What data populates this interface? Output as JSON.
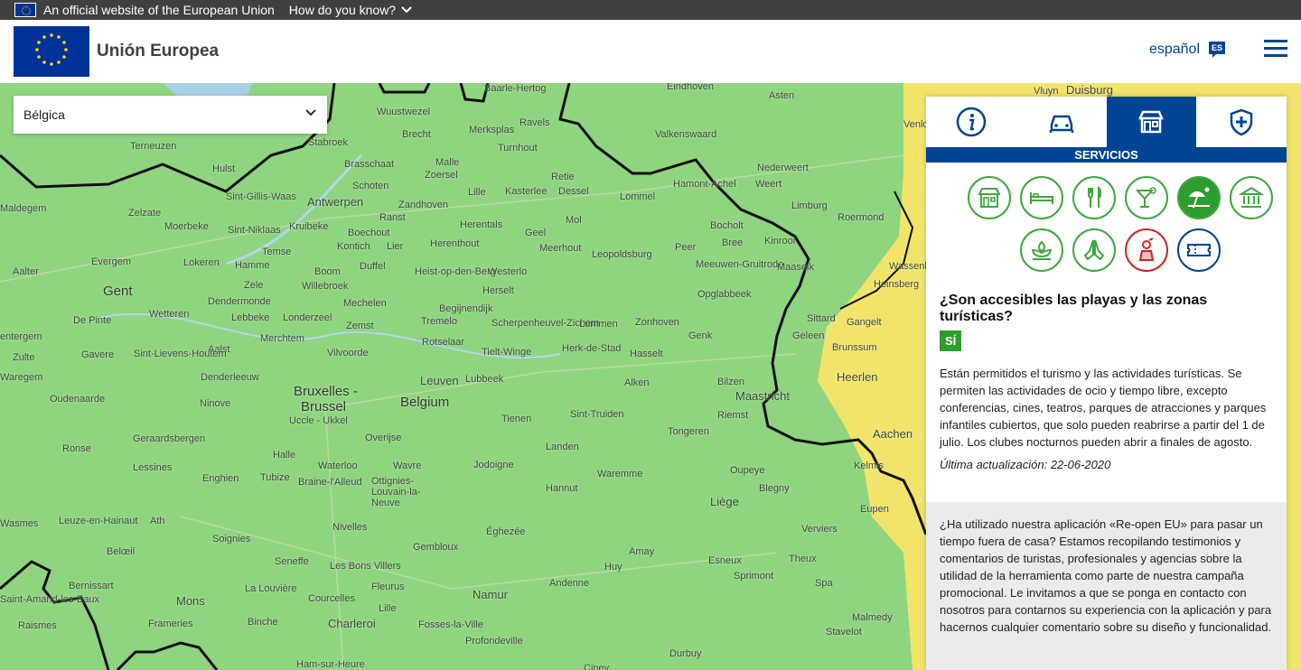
{
  "eu_bar": {
    "official_text": "An official website of the European Union",
    "how_text": "How do you know?"
  },
  "header": {
    "site_name": "Unión Europea",
    "language_label": "español",
    "language_code": "ES"
  },
  "country_select": {
    "value": "Bélgica"
  },
  "panel": {
    "tabs": [
      "info-icon",
      "car-icon",
      "shop-icon",
      "health-shield-icon"
    ],
    "active_tab": "SERVICIOS",
    "service_icons": [
      "shop-icon",
      "bed-icon",
      "restaurant-icon",
      "cocktail-icon",
      "beach-icon",
      "museum-icon",
      "spa-icon",
      "prayer-icon",
      "performer-icon",
      "ticket-icon"
    ],
    "question": "¿Son accesibles las playas y las zonas turísticas?",
    "status": "SÍ",
    "answer": "Están permitidos el turismo y las actividades turísticas. Se permiten las actividades de ocio y tiempo libre, excepto conferencias, cines, teatros, parques de atracciones y parques infantiles cubiertos, que solo pueden reabrirse a partir del 1 de julio. Los clubes nocturnos pueden abrir a finales de agosto.",
    "updated": "Última actualización: 22-06-2020",
    "promo": "¿Ha utilizado nuestra aplicación «Re-open EU» para pasar un tiempo fuera de casa? Estamos recopilando testimonios y comentarios de turistas, profesionales y agencias sobre la utilidad de la herramienta como parte de nuestra campaña promocional. Le invitamos a que se ponga en contacto con nosotros para contarnos su experiencia con la aplicación y para hacernos cualquier comentario sobre su diseño y funcionalidad."
  },
  "map": {
    "labels": {
      "wuustwezel": "Wuustwezel",
      "essen": "Essen",
      "baarle": "Baarle-Hertog",
      "eindhoven": "Eindhoven",
      "asten": "Asten",
      "duisburg": "Duisburg",
      "vluyn": "Vluyn",
      "brecht": "Brecht",
      "merksplas": "Merksplas",
      "ravels": "Ravels",
      "valkenswaard": "Valkenswaard",
      "venlo": "Venlo",
      "terneuzen": "Terneuzen",
      "stabroek": "Stabroek",
      "turnhout": "Turnhout",
      "hulst": "Hulst",
      "brasschaat": "Brasschaat",
      "malle": "Malle",
      "nederweert": "Nederweert",
      "zoersel": "Zoersel",
      "retie": "Retie",
      "hamont": "Hamont-Achel",
      "weert": "Weert",
      "schoten": "Schoten",
      "lille": "Lille",
      "kasterlee": "Kasterlee",
      "dessel": "Dessel",
      "lommel": "Lommel",
      "sintgillis": "Sint-Gillis-Waas",
      "antwerpen": "Antwerpen",
      "zandhoven": "Zandhoven",
      "limburg": "Limburg",
      "maldegem": "Maldegem",
      "zelzate": "Zelzate",
      "ranst": "Ranst",
      "roermond": "Roermond",
      "moerbeke": "Moerbeke",
      "sintniklaas": "Sint-Niklaas",
      "kruibeke": "Kruibeke",
      "boechout": "Boechout",
      "herentals": "Herentals",
      "geel": "Geel",
      "mol": "Mol",
      "bocholt": "Bocholt",
      "kinrooi": "Kinrooi",
      "temse": "Temse",
      "kontich": "Kontich",
      "lier": "Lier",
      "herenthout": "Herenthout",
      "meerhout": "Meerhout",
      "bree": "Bree",
      "peer": "Peer",
      "leopoldsburg": "Leopoldsburg",
      "aalter": "Aalter",
      "evergem": "Evergem",
      "lokeren": "Lokeren",
      "hamme": "Hamme",
      "duffel": "Duffel",
      "heistopdenberg": "Heist-op-den-Berg",
      "westerlo": "Westerlo",
      "meeuwen": "Meeuwen-Gruitrode",
      "maaseik": "Maaseik",
      "wassenb": "Wassenb",
      "heinsberg": "Heinsberg",
      "boom": "Boom",
      "willebroek": "Willebroek",
      "herselt": "Herselt",
      "gent": "Gent",
      "zele": "Zele",
      "dendermonde": "Dendermonde",
      "mechelen": "Mechelen",
      "begijnendijk": "Begijnendijk",
      "opglabbeek": "Opglabbeek",
      "depinte": "De Pinte",
      "wetteren": "Wetteren",
      "lebbeke": "Lebbeke",
      "londerzeel": "Londerzeel",
      "tremelo": "Tremelo",
      "scherpenheuvel": "Scherpenheuvel-Zichem",
      "lummen": "Lummen",
      "zonhoven": "Zonhoven",
      "sittard": "Sittard",
      "gangelt": "Gangelt",
      "zemst": "Zemst",
      "genk": "Genk",
      "geleen": "Geleen",
      "entergem": "entergem",
      "merchtem": "Merchtem",
      "rotselaar": "Rotselaar",
      "brunssum": "Brunssum",
      "zulte": "Zulte",
      "aalst": "Aalst",
      "sintlievens": "Sint-Lievens-Houtem",
      "vilvoorde": "Vilvoorde",
      "tieltwinge": "Tielt-Winge",
      "herkdestad": "Herk-de-Stad",
      "hasselt": "Hasselt",
      "gavere": "Gavere",
      "waregem": "Waregem",
      "denderleeuw": "Denderleeuw",
      "leuven": "Leuven",
      "lubbeek": "Lubbeek",
      "bilzen": "Bilzen",
      "heerlen": "Heerlen",
      "alken": "Alken",
      "oudenaarde": "Oudenaarde",
      "ninove": "Ninove",
      "bruxelles": "Bruxelles -",
      "brussel": "Brussel",
      "belgium": "Belgium",
      "maastricht": "Maastricht",
      "tienen": "Tienen",
      "uccle": "Uccle - Ukkel",
      "sinttruiden": "Sint-Truiden",
      "riemst": "Riemst",
      "tongeren": "Tongeren",
      "aachen": "Aachen",
      "eupen": "Eupen",
      "geraardsbergen": "Geraardsbergen",
      "halle": "Halle",
      "overijse": "Overijse",
      "landen": "Landen",
      "renaix": "Ronse",
      "waterloo": "Waterloo",
      "wavre": "Wavre",
      "jodoigne": "Jodoigne",
      "waremme": "Waremme",
      "oupeye": "Oupeye",
      "kelmis": "Kelmis",
      "lessines": "Lessines",
      "enghien": "Enghien",
      "tubize": "Tubize",
      "braine": "Braine-l'Alleud",
      "ottignies": "Ottignies-Louvain-la-Neuve",
      "hannut": "Hannut",
      "blegny": "Blegny",
      "liege": "Liège",
      "verviers": "Verviers",
      "leuzeen": "Leuze-en-Hainaut",
      "ath": "Ath",
      "nivelles": "Nivelles",
      "eghezee": "Éghezée",
      "soignies": "Soignies",
      "gembloux": "Gembloux",
      "amay": "Amay",
      "seneffe": "Seneffe",
      "lesbons": "Les Bons Villers",
      "huy": "Huy",
      "esneux": "Esneux",
      "theux": "Theux",
      "beloeil": "Belœil",
      "lalouviere": "La Louvière",
      "spa": "Spa",
      "bernissart": "Bernissart",
      "fleurus": "Fleurus",
      "namur": "Namur",
      "sprimont": "Sprimont",
      "mons": "Mons",
      "courcelles": "Courcelles",
      "andenne": "Andenne",
      "saintamand": "Saint-Amand-les-Eaux",
      "binche": "Binche",
      "charleroi": "Charleroi",
      "fossesla": "Fosses-la-Ville",
      "malmedy": "Malmedy",
      "raismes": "Raismes",
      "frameries": "Frameries",
      "profondeville": "Profondeville",
      "stavelot": "Stavelot",
      "durbuy": "Durbuy",
      "hamsur": "Ham-sur-Heure",
      "ciney": "Ciney",
      "lille2": "Lille",
      "ravels2": "Ravels",
      "wasmes": "Wasmes"
    }
  }
}
